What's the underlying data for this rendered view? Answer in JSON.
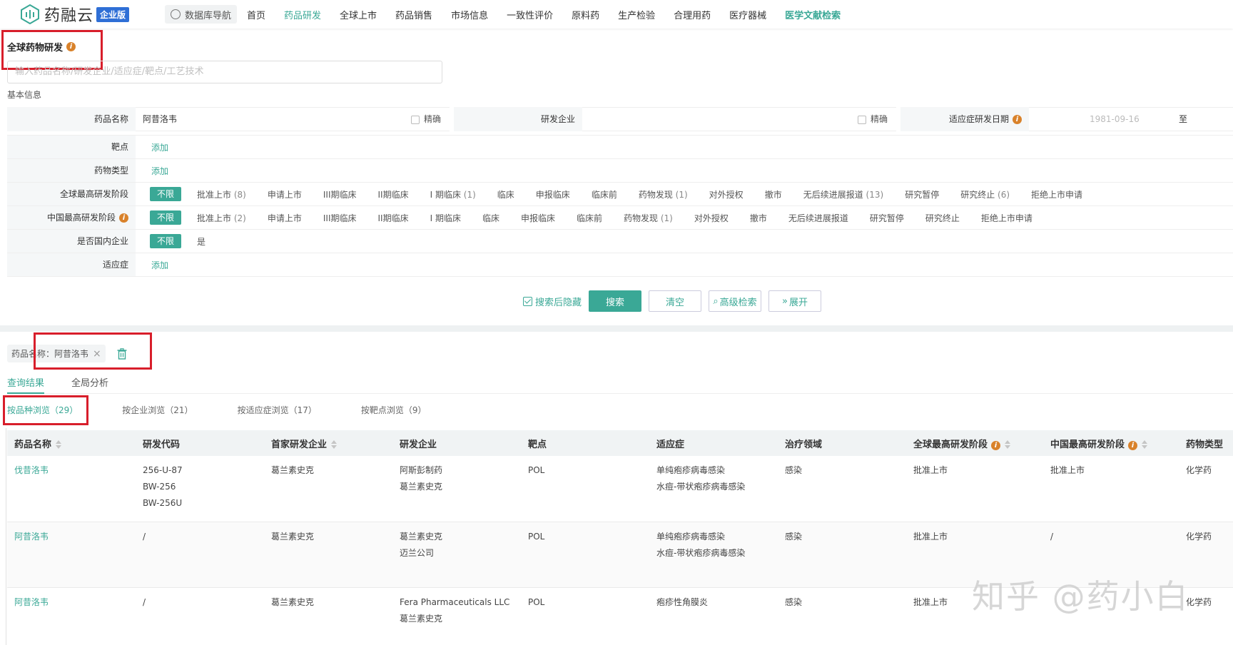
{
  "app": {
    "logo_text": "药融云",
    "edition_badge": "企业版",
    "db_nav_label": "数据库导航"
  },
  "nav": [
    {
      "label": "首页",
      "state": ""
    },
    {
      "label": "药品研发",
      "state": "active"
    },
    {
      "label": "全球上市",
      "state": ""
    },
    {
      "label": "药品销售",
      "state": ""
    },
    {
      "label": "市场信息",
      "state": ""
    },
    {
      "label": "一致性评价",
      "state": ""
    },
    {
      "label": "原料药",
      "state": ""
    },
    {
      "label": "生产检验",
      "state": ""
    },
    {
      "label": "合理用药",
      "state": ""
    },
    {
      "label": "医疗器械",
      "state": ""
    },
    {
      "label": "医学文献检索",
      "state": "lit"
    }
  ],
  "page": {
    "title": "全球药物研发",
    "search_placeholder": "输入药品名称/研发企业/适应症/靶点/工艺技术",
    "section_basic": "基本信息"
  },
  "basic": {
    "drug_name_label": "药品名称",
    "drug_name_value": "阿昔洛韦",
    "exact_label": "精确",
    "company_label": "研发企业",
    "company_value": "",
    "date_label": "适应症研发日期",
    "date_from": "1981-09-16",
    "date_to_label": "至"
  },
  "filters": {
    "target_label": "靶点",
    "drugtype_label": "药物类型",
    "add_label": "添加",
    "all_label": "不限",
    "global_stage_label": "全球最高研发阶段",
    "global_stages": [
      {
        "name": "批准上市",
        "count": "(8)"
      },
      {
        "name": "申请上市",
        "count": ""
      },
      {
        "name": "III期临床",
        "count": ""
      },
      {
        "name": "II期临床",
        "count": ""
      },
      {
        "name": "I 期临床",
        "count": "(1)"
      },
      {
        "name": "临床",
        "count": ""
      },
      {
        "name": "申报临床",
        "count": ""
      },
      {
        "name": "临床前",
        "count": ""
      },
      {
        "name": "药物发现",
        "count": "(1)"
      },
      {
        "name": "对外授权",
        "count": ""
      },
      {
        "name": "撤市",
        "count": ""
      },
      {
        "name": "无后续进展报道",
        "count": "(13)"
      },
      {
        "name": "研究暂停",
        "count": ""
      },
      {
        "name": "研究终止",
        "count": "(6)"
      },
      {
        "name": "拒绝上市申请",
        "count": ""
      }
    ],
    "china_stage_label": "中国最高研发阶段",
    "china_stages": [
      {
        "name": "批准上市",
        "count": "(2)"
      },
      {
        "name": "申请上市",
        "count": ""
      },
      {
        "name": "III期临床",
        "count": ""
      },
      {
        "name": "II期临床",
        "count": ""
      },
      {
        "name": "I 期临床",
        "count": ""
      },
      {
        "name": "临床",
        "count": ""
      },
      {
        "name": "申报临床",
        "count": ""
      },
      {
        "name": "临床前",
        "count": ""
      },
      {
        "name": "药物发现",
        "count": "(1)"
      },
      {
        "name": "对外授权",
        "count": ""
      },
      {
        "name": "撤市",
        "count": ""
      },
      {
        "name": "无后续进展报道",
        "count": ""
      },
      {
        "name": "研究暂停",
        "count": ""
      },
      {
        "name": "研究终止",
        "count": ""
      },
      {
        "name": "拒绝上市申请",
        "count": ""
      }
    ],
    "domestic_label": "是否国内企业",
    "domestic_yes": "是",
    "indication_label": "适应症"
  },
  "actions": {
    "hide_after_search": "搜索后隐藏",
    "search": "搜索",
    "clear": "清空",
    "advanced": "高级检索",
    "expand": "展开"
  },
  "chip": {
    "text": "药品名称：阿昔洛韦"
  },
  "tabs": {
    "results": "查询结果",
    "analysis": "全局分析"
  },
  "subtabs": [
    {
      "label": "按品种浏览（29）",
      "active": true
    },
    {
      "label": "按企业浏览（21）",
      "active": false
    },
    {
      "label": "按适应症浏览（17）",
      "active": false
    },
    {
      "label": "按靶点浏览（9）",
      "active": false
    }
  ],
  "table": {
    "headers": [
      "药品名称",
      "研发代码",
      "首家研发企业",
      "研发企业",
      "靶点",
      "适应症",
      "治疗领域",
      "全球最高研发阶段",
      "中国最高研发阶段",
      "药物类型"
    ],
    "rows": [
      {
        "name": "伐昔洛韦",
        "code": [
          "256-U-87",
          "BW-256",
          "BW-256U"
        ],
        "first_company": "葛兰素史克",
        "companies": [
          "阿斯彭制药",
          "葛兰素史克"
        ],
        "target": "POL",
        "indications": [
          "单纯疱疹病毒感染",
          "水痘-带状疱疹病毒感染"
        ],
        "area": "感染",
        "global_stage": "批准上市",
        "china_stage": "批准上市",
        "type": "化学药"
      },
      {
        "name": "阿昔洛韦",
        "code": [
          "/"
        ],
        "first_company": "葛兰素史克",
        "companies": [
          "葛兰素史克",
          "迈兰公司"
        ],
        "target": "POL",
        "indications": [
          "单纯疱疹病毒感染",
          "水痘-带状疱疹病毒感染"
        ],
        "area": "感染",
        "global_stage": "批准上市",
        "china_stage": "/",
        "type": "化学药"
      },
      {
        "name": "阿昔洛韦",
        "code": [
          "/"
        ],
        "first_company": "葛兰素史克",
        "companies": [
          "Fera Pharmaceuticals LLC",
          "葛兰素史克"
        ],
        "target": "POL",
        "indications": [
          "疱疹性角膜炎"
        ],
        "area": "感染",
        "global_stage": "批准上市",
        "china_stage": "",
        "type": "化学药"
      }
    ]
  },
  "watermark": "知乎 @药小白",
  "colors": {
    "accent": "#3aa896",
    "highlight": "#d81e2b",
    "badge": "#2f6fd6"
  }
}
